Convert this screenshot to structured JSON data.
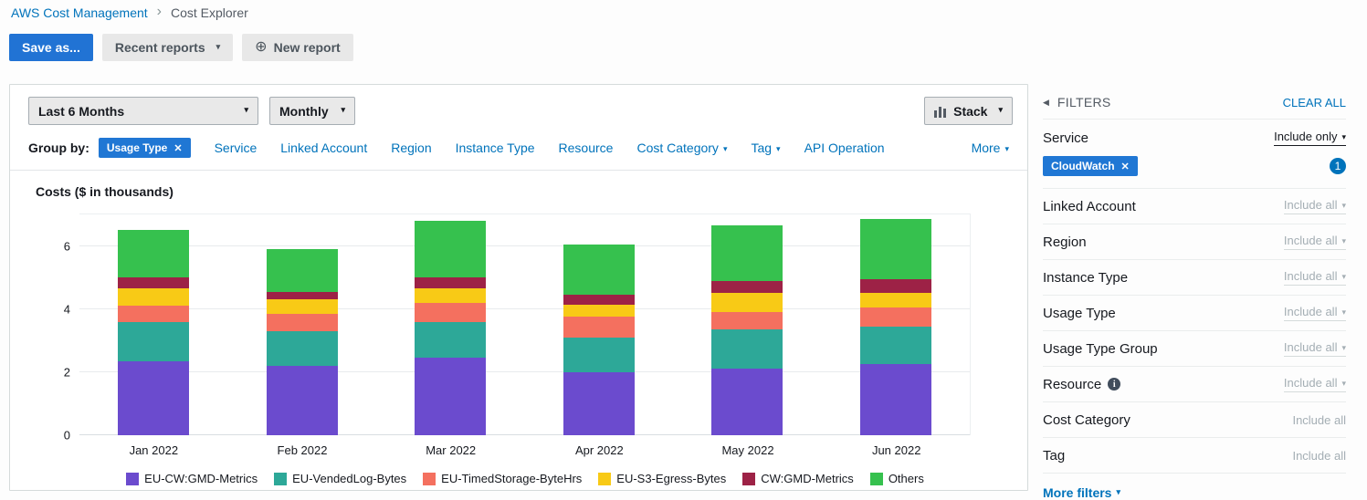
{
  "breadcrumb": {
    "root": "AWS Cost Management",
    "current": "Cost Explorer"
  },
  "toolbar": {
    "save_as": "Save as...",
    "recent_reports": "Recent reports",
    "new_report": "New report"
  },
  "controls": {
    "time_range": "Last 6 Months",
    "granularity": "Monthly",
    "chart_style": "Stack"
  },
  "group_by": {
    "label": "Group by:",
    "selected_chip": "Usage Type",
    "links": [
      {
        "label": "Service",
        "caret": false
      },
      {
        "label": "Linked Account",
        "caret": false
      },
      {
        "label": "Region",
        "caret": false
      },
      {
        "label": "Instance Type",
        "caret": false
      },
      {
        "label": "Resource",
        "caret": false
      },
      {
        "label": "Cost Category",
        "caret": true
      },
      {
        "label": "Tag",
        "caret": true
      },
      {
        "label": "API Operation",
        "caret": false
      }
    ],
    "more": "More"
  },
  "chart_data": {
    "type": "bar",
    "stacked": true,
    "title": "Costs ($ in thousands)",
    "categories": [
      "Jan 2022",
      "Feb 2022",
      "Mar 2022",
      "Apr 2022",
      "May 2022",
      "Jun 2022"
    ],
    "series": [
      {
        "name": "EU-CW:GMD-Metrics",
        "color": "#6b4bce",
        "values": [
          2.35,
          2.2,
          2.45,
          2.0,
          2.1,
          2.25
        ]
      },
      {
        "name": "EU-VendedLog-Bytes",
        "color": "#2da898",
        "values": [
          1.25,
          1.1,
          1.15,
          1.1,
          1.25,
          1.2
        ]
      },
      {
        "name": "EU-TimedStorage-ByteHrs",
        "color": "#f4705f",
        "values": [
          0.5,
          0.55,
          0.6,
          0.65,
          0.55,
          0.6
        ]
      },
      {
        "name": "EU-S3-Egress-Bytes",
        "color": "#f8ca16",
        "values": [
          0.55,
          0.45,
          0.45,
          0.4,
          0.6,
          0.45
        ]
      },
      {
        "name": "CW:GMD-Metrics",
        "color": "#9d2246",
        "values": [
          0.35,
          0.25,
          0.35,
          0.3,
          0.4,
          0.45
        ]
      },
      {
        "name": "Others",
        "color": "#36c14e",
        "values": [
          1.5,
          1.35,
          1.8,
          1.6,
          1.75,
          1.9
        ]
      }
    ],
    "ylim": [
      0,
      7
    ],
    "yticks": [
      0,
      2,
      4,
      6
    ],
    "grid": true,
    "legend_position": "bottom"
  },
  "filters": {
    "title": "FILTERS",
    "clear_all": "CLEAR ALL",
    "service": {
      "label": "Service",
      "value": "Include only",
      "chip": "CloudWatch",
      "count": "1"
    },
    "rows": [
      {
        "label": "Linked Account",
        "value": "Include all",
        "caret": true
      },
      {
        "label": "Region",
        "value": "Include all",
        "caret": true
      },
      {
        "label": "Instance Type",
        "value": "Include all",
        "caret": true
      },
      {
        "label": "Usage Type",
        "value": "Include all",
        "caret": true
      },
      {
        "label": "Usage Type Group",
        "value": "Include all",
        "caret": true
      },
      {
        "label": "Resource",
        "value": "Include all",
        "caret": true,
        "info": true
      },
      {
        "label": "Cost Category",
        "value": "Include all",
        "caret": false
      },
      {
        "label": "Tag",
        "value": "Include all",
        "caret": false
      }
    ],
    "more_filters": "More filters"
  },
  "colors": {
    "link": "#0073bb",
    "primary_button": "#2173d4",
    "chip": "#2077d4",
    "badge": "#0073bb"
  }
}
